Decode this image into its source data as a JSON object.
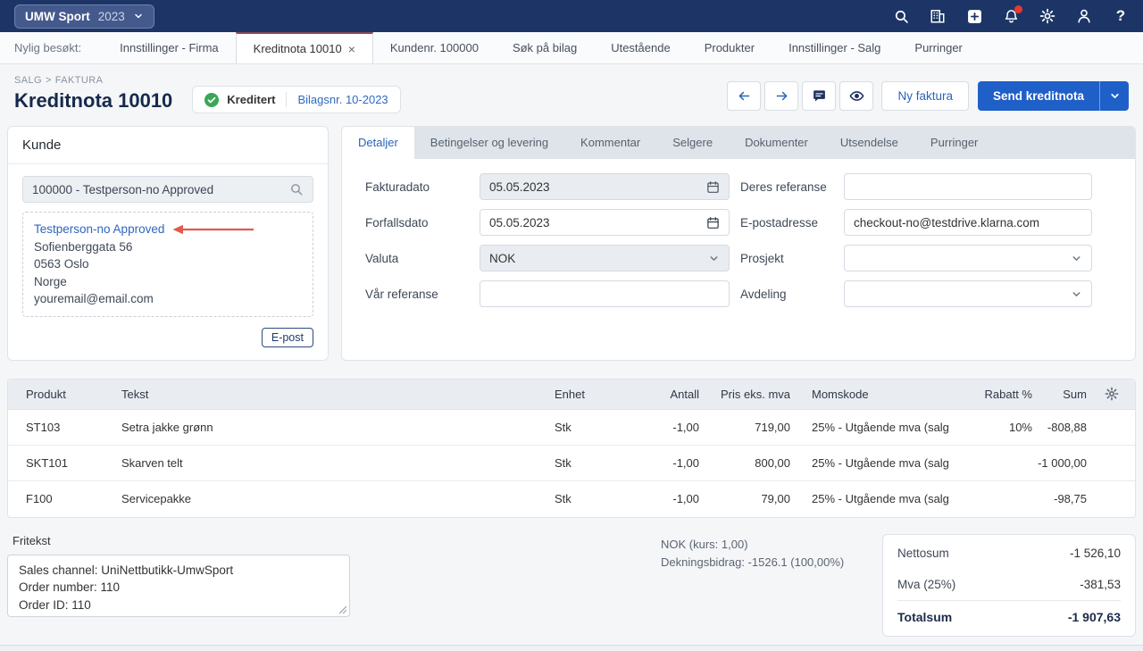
{
  "topbar": {
    "company": "UMW Sport",
    "year": "2023",
    "help_glyph": "?",
    "icons": [
      "search-icon",
      "company-register-icon",
      "add-new-icon",
      "notifications-icon",
      "settings-icon",
      "user-icon",
      "help-icon"
    ]
  },
  "recent_nav": {
    "label": "Nylig besøkt:",
    "close_symbol": "×",
    "items": [
      {
        "label": "Innstillinger - Firma",
        "active": false
      },
      {
        "label": "Kreditnota 10010",
        "active": true
      },
      {
        "label": "Kundenr. 100000",
        "active": false
      },
      {
        "label": "Søk på bilag",
        "active": false
      },
      {
        "label": "Utestående",
        "active": false
      },
      {
        "label": "Produkter",
        "active": false
      },
      {
        "label": "Innstillinger - Salg",
        "active": false
      },
      {
        "label": "Purringer",
        "active": false
      }
    ]
  },
  "header": {
    "breadcrumb": [
      "SALG",
      "FAKTURA"
    ],
    "breadcrumb_sep": ">",
    "title": "Kreditnota 10010",
    "status": "Kreditert",
    "voucher_link": "Bilagsnr. 10-2023",
    "new_invoice_button": "Ny faktura",
    "send_button": "Send kreditnota"
  },
  "customer": {
    "title": "Kunde",
    "search_value": "100000 - Testperson-no Approved",
    "name": "Testperson-no Approved",
    "address_lines": [
      "Sofienberggata 56",
      "0563 Oslo",
      "Norge",
      "youremail@email.com"
    ],
    "email_button": "E-post"
  },
  "details": {
    "tabs": [
      "Detaljer",
      "Betingelser og levering",
      "Kommentar",
      "Selgere",
      "Dokumenter",
      "Utsendelse",
      "Purringer"
    ],
    "active_tab": "Detaljer",
    "fields_left": [
      {
        "label": "Fakturadato",
        "value": "05.05.2023",
        "type": "date",
        "disabled": true
      },
      {
        "label": "Forfallsdato",
        "value": "05.05.2023",
        "type": "date",
        "disabled": false
      },
      {
        "label": "Valuta",
        "value": "NOK",
        "type": "select",
        "disabled": true
      },
      {
        "label": "Vår referanse",
        "value": "",
        "type": "text",
        "disabled": false
      }
    ],
    "fields_right": [
      {
        "label": "Deres referanse",
        "value": "",
        "type": "text",
        "disabled": false
      },
      {
        "label": "E-postadresse",
        "value": "checkout-no@testdrive.klarna.com",
        "type": "text",
        "disabled": false
      },
      {
        "label": "Prosjekt",
        "value": "",
        "type": "select",
        "disabled": false
      },
      {
        "label": "Avdeling",
        "value": "",
        "type": "select",
        "disabled": false
      }
    ]
  },
  "table": {
    "headers": [
      "Produkt",
      "Tekst",
      "Enhet",
      "Antall",
      "Pris eks. mva",
      "Momskode",
      "Rabatt %",
      "Sum"
    ],
    "rows": [
      {
        "product": "ST103",
        "text": "Setra jakke grønn",
        "unit": "Stk",
        "qty": "-1,00",
        "price": "719,00",
        "vat": "25% - Utgående mva (salg",
        "discount": "10%",
        "sum": "-808,88"
      },
      {
        "product": "SKT101",
        "text": "Skarven telt",
        "unit": "Stk",
        "qty": "-1,00",
        "price": "800,00",
        "vat": "25% - Utgående mva (salg",
        "discount": "",
        "sum": "-1 000,00"
      },
      {
        "product": "F100",
        "text": "Servicepakke",
        "unit": "Stk",
        "qty": "-1,00",
        "price": "79,00",
        "vat": "25% - Utgående mva (salg",
        "discount": "",
        "sum": "-98,75"
      }
    ]
  },
  "footer": {
    "fritekst_label": "Fritekst",
    "fritekst_lines": [
      "Sales channel: UniNettbutikk-UmwSport",
      "Order number: 110",
      "Order ID: 110"
    ],
    "currency_info": "NOK (kurs: 1,00)",
    "margin_info": "Dekningsbidrag: -1526.1 (100,00%)",
    "totals": [
      {
        "label": "Nettosum",
        "value": "-1 526,10"
      },
      {
        "label": "Mva (25%)",
        "value": "-381,53"
      }
    ],
    "total_label": "Totalsum",
    "total_value": "-1 907,63"
  },
  "colors": {
    "navy": "#1d3566",
    "primary_blue": "#1f5fc8",
    "link_blue": "#3069c0",
    "status_green": "#3aa757",
    "alert_red": "#e8392f",
    "annotation_red": "#e05a4e"
  }
}
